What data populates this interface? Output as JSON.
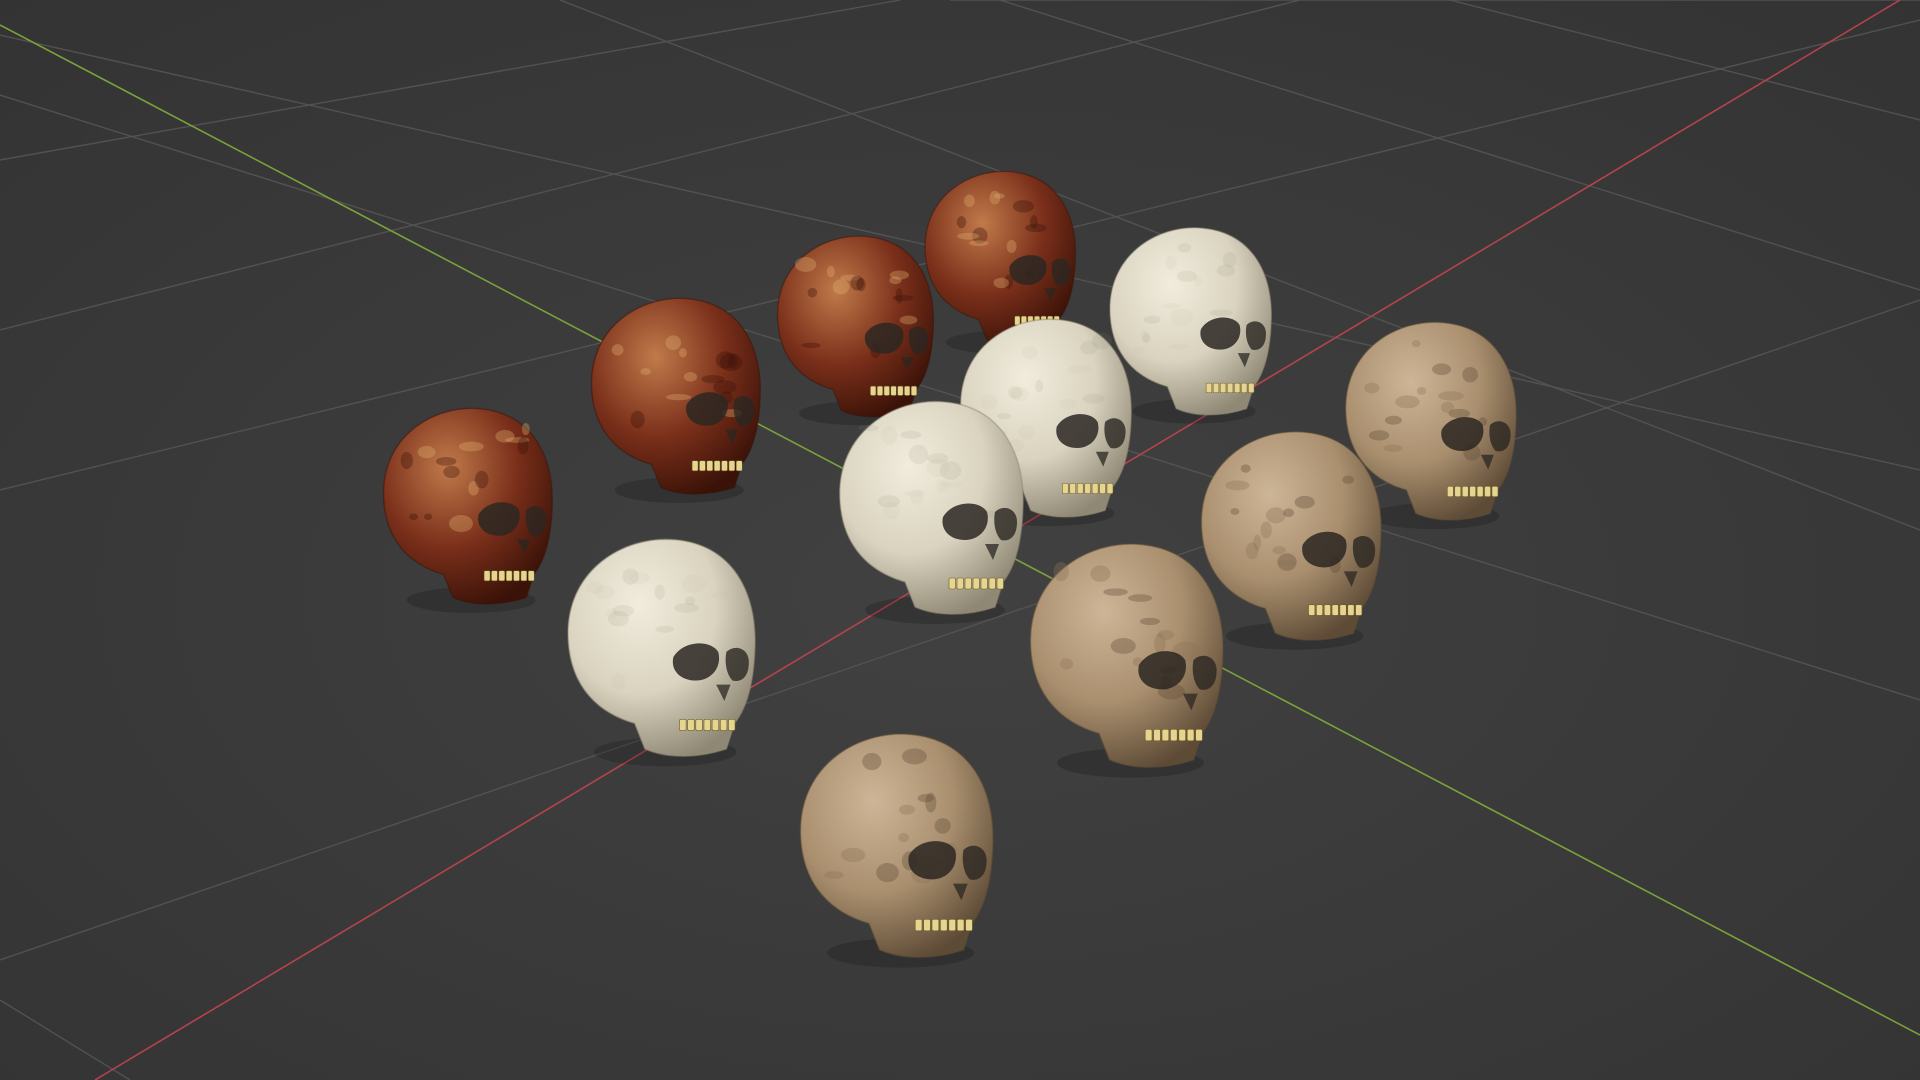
{
  "viewport": {
    "background": "#3d3d3d",
    "grid_color": "#555555",
    "x_axis_color": "#b5434e",
    "y_axis_color": "#7aa23a"
  },
  "materials": {
    "marbled_red": {
      "base": "#7a2f1a",
      "light": "#c07a4a",
      "dark": "#3a1208",
      "spot": "#e0b070"
    },
    "ivory": {
      "base": "#d9d3bf",
      "light": "#f1ecdd",
      "dark": "#8e8874",
      "spot": "#c9c0a5"
    },
    "weathered_tan": {
      "base": "#a98f6e",
      "light": "#cdb597",
      "dark": "#5e4b36",
      "spot": "#8b7355"
    }
  },
  "objects": [
    {
      "name": "skull-marbled-red",
      "material": "marbled_red"
    },
    {
      "name": "skull-marbled-red",
      "material": "marbled_red"
    },
    {
      "name": "skull-marbled-red",
      "material": "marbled_red"
    },
    {
      "name": "skull-marbled-red",
      "material": "marbled_red"
    },
    {
      "name": "skull-ivory",
      "material": "ivory"
    },
    {
      "name": "skull-ivory",
      "material": "ivory"
    },
    {
      "name": "skull-ivory",
      "material": "ivory"
    },
    {
      "name": "skull-ivory",
      "material": "ivory"
    },
    {
      "name": "skull-weathered-tan",
      "material": "weathered_tan"
    },
    {
      "name": "skull-weathered-tan",
      "material": "weathered_tan"
    },
    {
      "name": "skull-weathered-tan",
      "material": "weathered_tan"
    },
    {
      "name": "skull-weathered-tan",
      "material": "weathered_tan"
    }
  ]
}
